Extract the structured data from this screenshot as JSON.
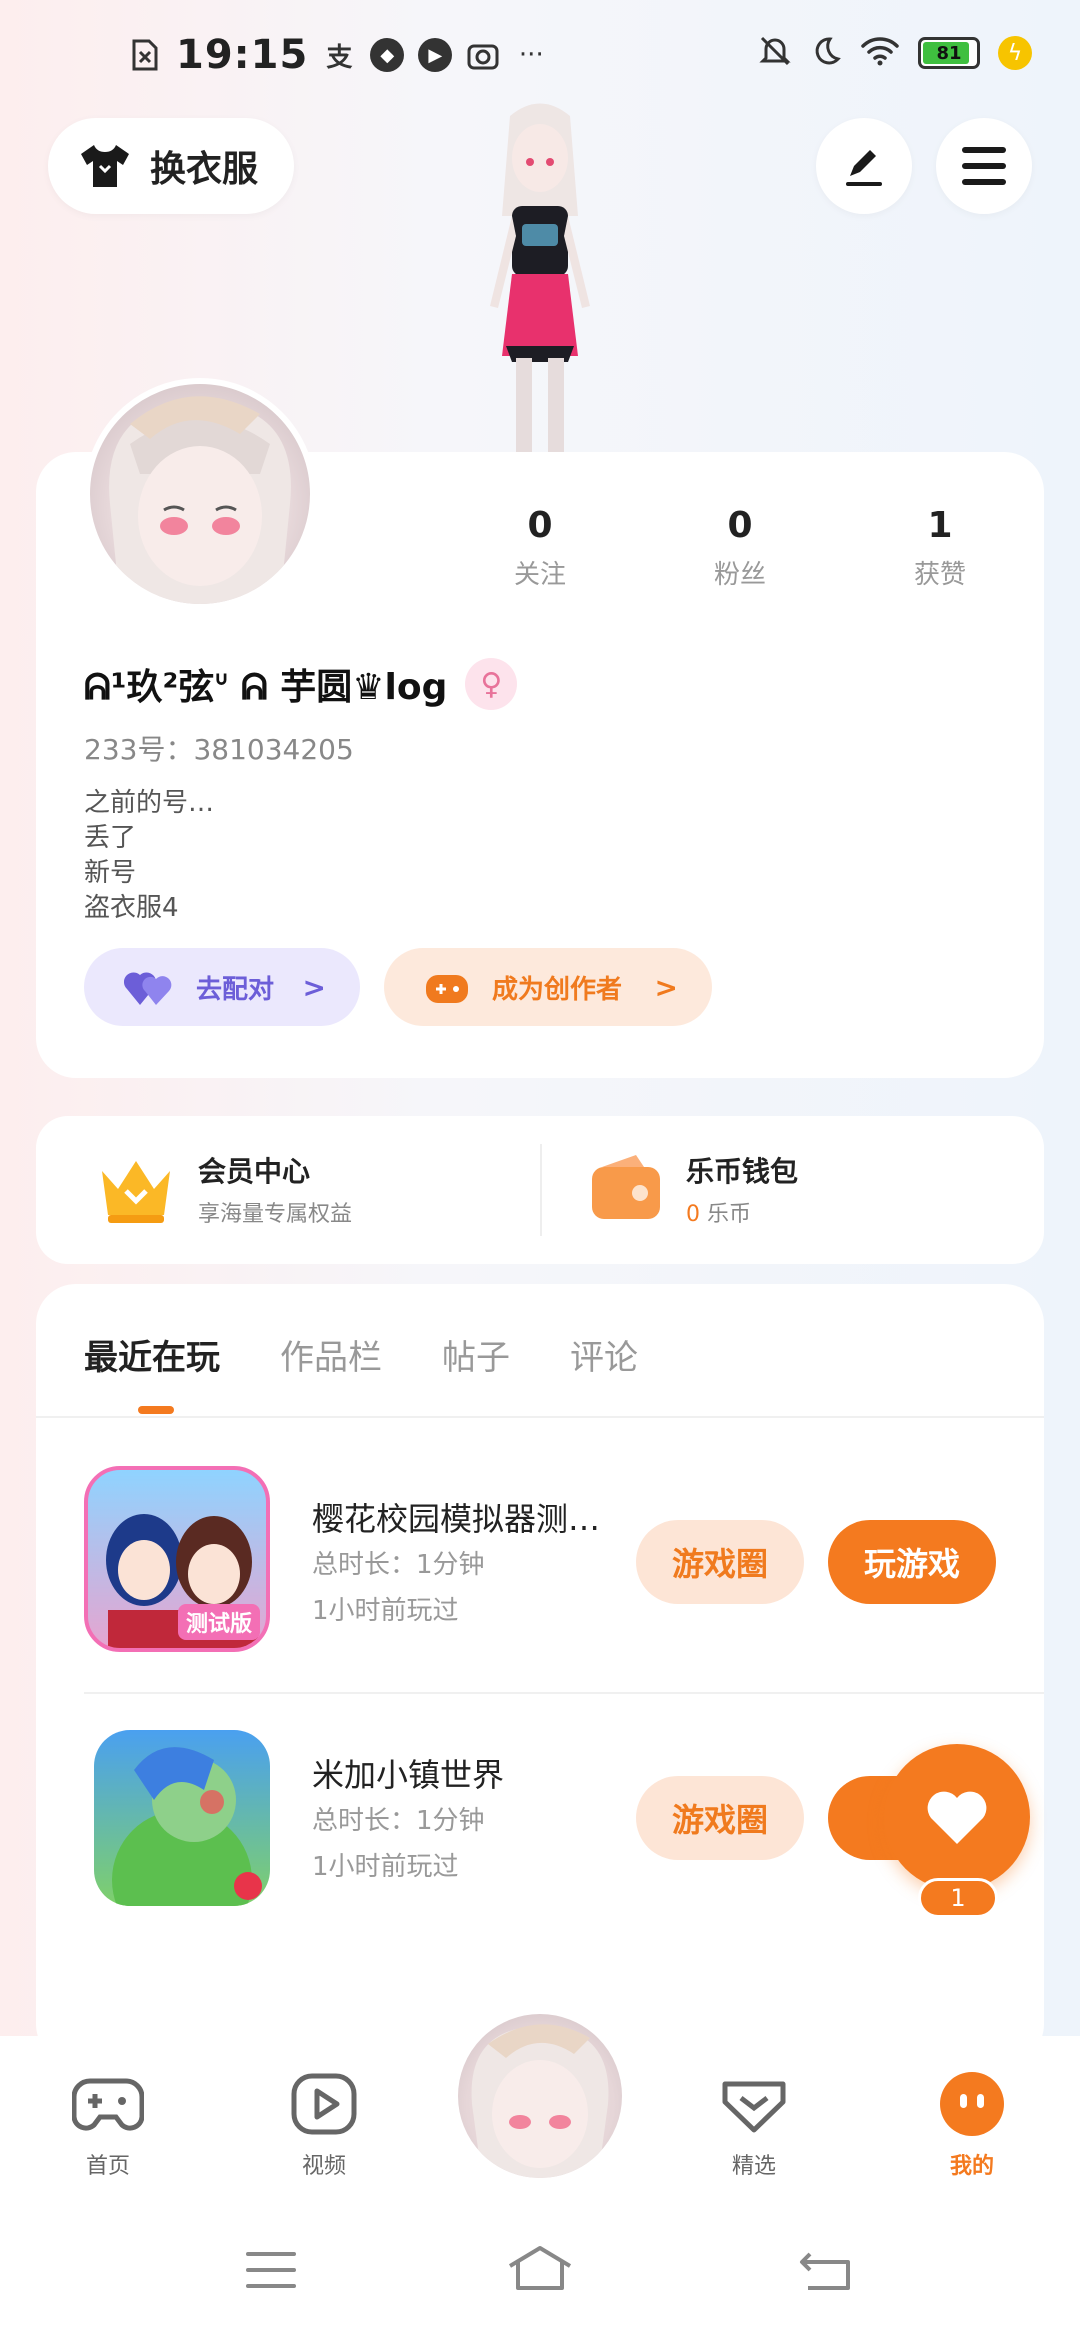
{
  "status_bar": {
    "time": "19:15",
    "battery": "81"
  },
  "header": {
    "outfit_label": "换衣服"
  },
  "profile": {
    "stats": [
      {
        "num": "0",
        "label": "关注"
      },
      {
        "num": "0",
        "label": "粉丝"
      },
      {
        "num": "1",
        "label": "获赞"
      }
    ],
    "nickname": "ᕱ¹玖²弦ᐡ ᕱ 芋圆♛log",
    "gender_symbol": "♀",
    "uid": "233号：381034205",
    "bio": [
      "之前的号…",
      "丢了",
      "新号",
      "盗衣服4"
    ],
    "match_label": "去配对",
    "creator_label": "成为创作者"
  },
  "member": {
    "vip_title": "会员中心",
    "vip_sub": "享海量专属权益",
    "wallet_title": "乐币钱包",
    "wallet_amount": "0",
    "wallet_unit": "乐币"
  },
  "tabs": [
    "最近在玩",
    "作品栏",
    "帖子",
    "评论"
  ],
  "games": [
    {
      "title": "樱花校园模拟器测…",
      "duration": "总时长：1分钟",
      "last_played": "1小时前玩过",
      "circle_label": "游戏圈",
      "play_label": "玩游戏",
      "icon_badge": "测试版"
    },
    {
      "title": "米加小镇世界",
      "duration": "总时长：1分钟",
      "last_played": "1小时前玩过",
      "circle_label": "游戏圈",
      "play_label": "玩"
    }
  ],
  "fab": {
    "count": "1"
  },
  "bottom_nav": [
    {
      "label": "首页"
    },
    {
      "label": "视频"
    },
    {
      "label": "精选"
    },
    {
      "label": "我的"
    }
  ],
  "colors": {
    "accent": "#f47a1f",
    "match": "#6c5ed8",
    "gender": "#e8739a"
  }
}
